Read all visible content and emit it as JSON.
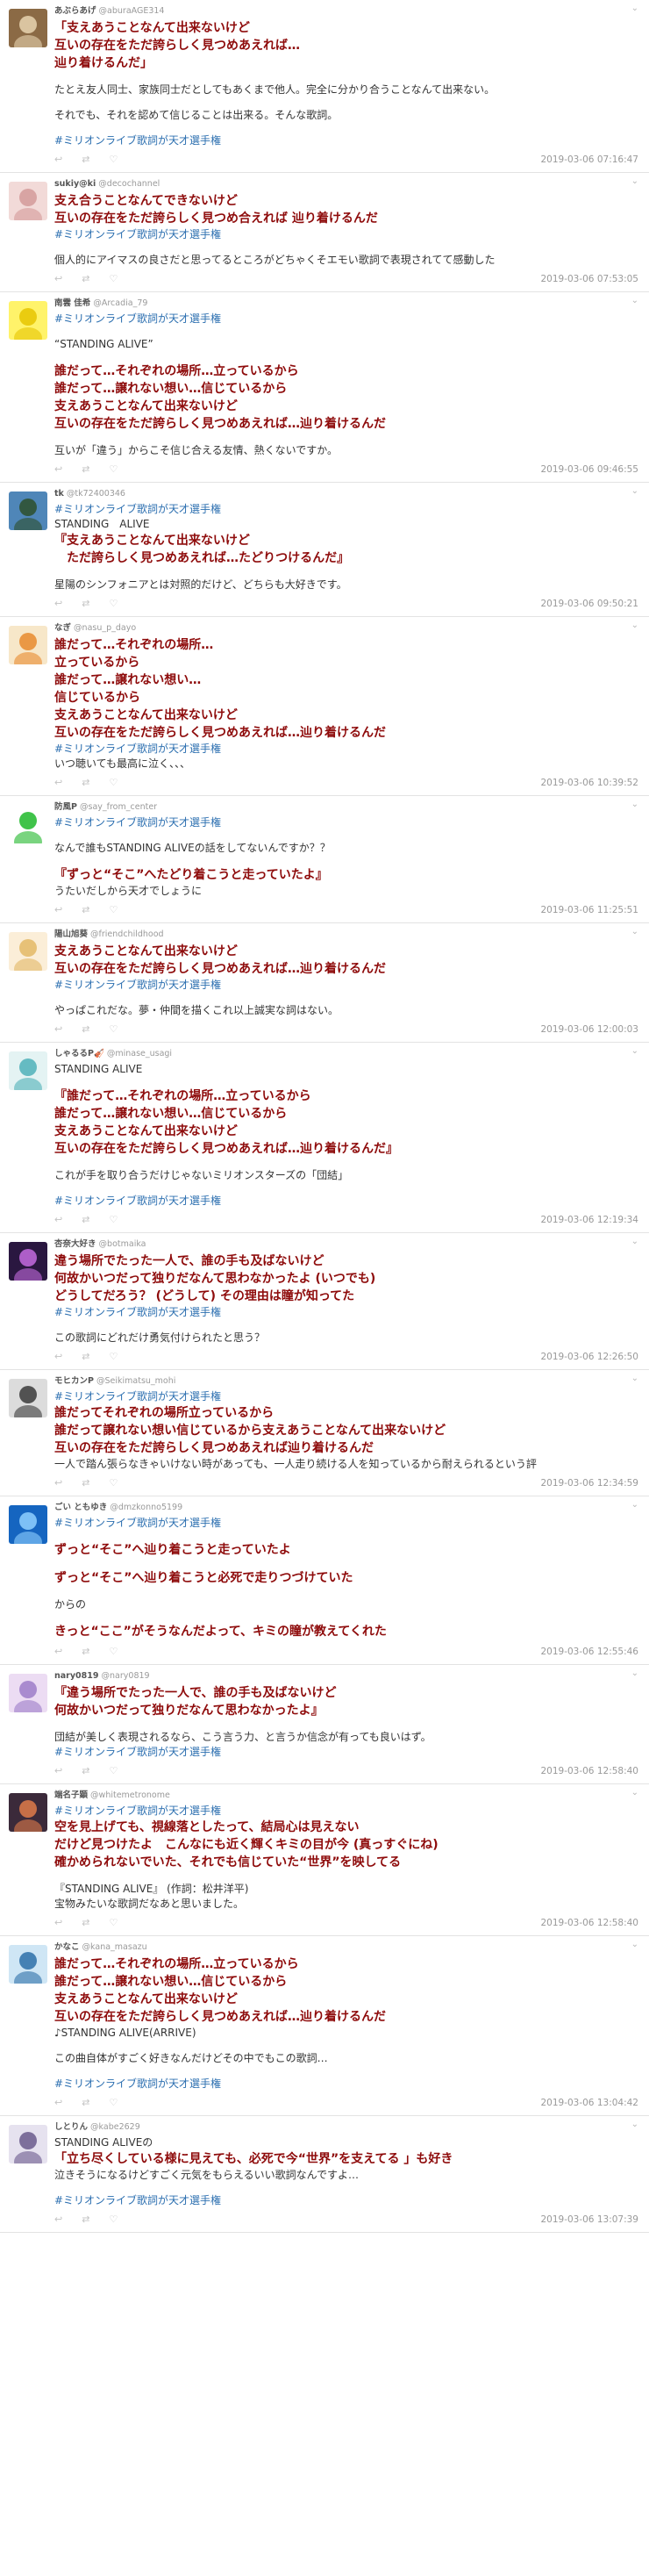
{
  "tweets": [
    {
      "display_name": "あぶらあげ",
      "handle": "@aburaAGE314",
      "avatar": {
        "icon": "brown-cat-avatar",
        "bg": "#8b6a45",
        "fg": "#e8d3b0"
      },
      "lines": [
        {
          "k": "q",
          "text": "「支えあうことなんて出来ないけど"
        },
        {
          "k": "q",
          "text": "互いの存在をただ誇らしく見つめあえれば…"
        },
        {
          "k": "q",
          "text": "辿り着けるんだ」"
        },
        {
          "k": "gap",
          "text": ""
        },
        {
          "k": "t",
          "text": "たとえ友人同士、家族同士だとしてもあくまで他人。完全に分かり合うことなんて出来ない。"
        },
        {
          "k": "gap",
          "text": ""
        },
        {
          "k": "t",
          "text": "それでも、それを認めて信じることは出来る。そんな歌詞。"
        },
        {
          "k": "gap",
          "text": ""
        },
        {
          "k": "h",
          "text": "#ミリオンライブ歌詞が天才選手権"
        }
      ],
      "time": "2019-03-06 07:16:47"
    },
    {
      "display_name": "sukiy@ki",
      "handle": "@decochannel",
      "avatar": {
        "icon": "pink-hair-girl-avatar",
        "bg": "#f2dad8",
        "fg": "#d49a9a"
      },
      "lines": [
        {
          "k": "q",
          "text": "支え合うことなんてできないけど"
        },
        {
          "k": "q",
          "text": "互いの存在をただ誇らしく見つめ合えれば 辿り着けるんだ"
        },
        {
          "k": "h",
          "text": "#ミリオンライブ歌詞が天才選手権"
        },
        {
          "k": "gap",
          "text": ""
        },
        {
          "k": "t",
          "text": "個人的にアイマスの良さだと思ってるところがどちゃくそエモい歌詞で表現されてて感動した"
        }
      ],
      "time": "2019-03-06 07:53:05"
    },
    {
      "display_name": "南雲 佳希",
      "handle": "@Arcadia_79",
      "avatar": {
        "icon": "yellow-emblem-avatar",
        "bg": "#fff36a",
        "fg": "#e6c400"
      },
      "lines": [
        {
          "k": "h",
          "text": "#ミリオンライブ歌詞が天才選手権"
        },
        {
          "k": "gap",
          "text": ""
        },
        {
          "k": "t",
          "text": "“STANDING ALIVE”"
        },
        {
          "k": "gap",
          "text": ""
        },
        {
          "k": "q",
          "text": "誰だって…それぞれの場所…立っているから"
        },
        {
          "k": "q",
          "text": "誰だって…譲れない想い…信じているから"
        },
        {
          "k": "q",
          "text": "支えあうことなんて出来ないけど"
        },
        {
          "k": "q",
          "text": "互いの存在をただ誇らしく見つめあえれば…辿り着けるんだ"
        },
        {
          "k": "gap",
          "text": ""
        },
        {
          "k": "t",
          "text": "互いが「違う」からこそ信じ合える友情、熱くないですか。"
        }
      ],
      "time": "2019-03-06 09:46:55"
    },
    {
      "display_name": "tk",
      "handle": "@tk72400346",
      "avatar": {
        "icon": "landscape-photo-avatar",
        "bg": "#4f86b8",
        "fg": "#2d4f2a"
      },
      "lines": [
        {
          "k": "h",
          "text": "#ミリオンライブ歌詞が天才選手権"
        },
        {
          "k": "t",
          "text": "STANDING　ALIVE"
        },
        {
          "k": "q",
          "text": "『支えあうことなんて出来ないけど"
        },
        {
          "k": "q",
          "text": "　ただ誇らしく見つめあえれば…たどりつけるんだ』"
        },
        {
          "k": "gap",
          "text": ""
        },
        {
          "k": "t",
          "text": "星陽のシンフォニアとは対照的だけど、どちらも大好きです。"
        }
      ],
      "time": "2019-03-06 09:50:21"
    },
    {
      "display_name": "なぎ",
      "handle": "@nasu_p_dayo",
      "avatar": {
        "icon": "orange-hair-girl-avatar",
        "bg": "#f7e7c9",
        "fg": "#e88a2e"
      },
      "lines": [
        {
          "k": "q",
          "text": "誰だって…それぞれの場所…"
        },
        {
          "k": "q",
          "text": "立っているから"
        },
        {
          "k": "q",
          "text": "誰だって…譲れない想い…"
        },
        {
          "k": "q",
          "text": "信じているから"
        },
        {
          "k": "q",
          "text": "支えあうことなんて出来ないけど"
        },
        {
          "k": "q",
          "text": "互いの存在をただ誇らしく見つめあえれば…辿り着けるんだ"
        },
        {
          "k": "h",
          "text": "#ミリオンライブ歌詞が天才選手権"
        },
        {
          "k": "t",
          "text": "いつ聴いても最高に泣く、、、"
        }
      ],
      "time": "2019-03-06 10:39:52"
    },
    {
      "display_name": "防風P",
      "handle": "@say_from_center",
      "avatar": {
        "icon": "green-shape-avatar",
        "bg": "#ffffff",
        "fg": "#1fb82a"
      },
      "lines": [
        {
          "k": "h",
          "text": "#ミリオンライブ歌詞が天才選手権"
        },
        {
          "k": "gap",
          "text": ""
        },
        {
          "k": "t",
          "text": "なんで誰もSTANDING ALIVEの話をしてないんですか？？"
        },
        {
          "k": "gap",
          "text": ""
        },
        {
          "k": "q",
          "text": "『ずっと“そこ”へたどり着こうと走っていたよ』"
        },
        {
          "k": "t",
          "text": "うたいだしから天才でしょうに"
        }
      ],
      "time": "2019-03-06 11:25:51"
    },
    {
      "display_name": "陽山旭葵",
      "handle": "@friendchildhood",
      "avatar": {
        "icon": "blonde-girl-avatar",
        "bg": "#fbeed8",
        "fg": "#e3b866"
      },
      "lines": [
        {
          "k": "q",
          "text": "支えあうことなんて出来ないけど"
        },
        {
          "k": "q",
          "text": "互いの存在をただ誇らしく見つめあえれば…辿り着けるんだ"
        },
        {
          "k": "h",
          "text": "#ミリオンライブ歌詞が天才選手権"
        },
        {
          "k": "gap",
          "text": ""
        },
        {
          "k": "t",
          "text": "やっぱこれだな。夢・仲間を描くこれ以上誠実な詞はない。"
        }
      ],
      "time": "2019-03-06 12:00:03"
    },
    {
      "display_name": "しゃるるP🎻",
      "handle": "@minase_usagi",
      "avatar": {
        "icon": "teal-hair-girl-avatar",
        "bg": "#e4f3f3",
        "fg": "#4fb0b8"
      },
      "lines": [
        {
          "k": "t",
          "text": "STANDING ALIVE"
        },
        {
          "k": "gap",
          "text": ""
        },
        {
          "k": "q",
          "text": "『誰だって…それぞれの場所…立っているから"
        },
        {
          "k": "q",
          "text": "誰だって…譲れない想い…信じているから"
        },
        {
          "k": "q",
          "text": "支えあうことなんて出来ないけど"
        },
        {
          "k": "q",
          "text": "互いの存在をただ誇らしく見つめあえれば…辿り着けるんだ』"
        },
        {
          "k": "gap",
          "text": ""
        },
        {
          "k": "t",
          "text": "これが手を取り合うだけじゃないミリオンスターズの「団結」"
        },
        {
          "k": "gap",
          "text": ""
        },
        {
          "k": "h",
          "text": "#ミリオンライブ歌詞が天才選手権"
        }
      ],
      "time": "2019-03-06 12:19:34"
    },
    {
      "display_name": "杏奈大好き",
      "handle": "@botmaika",
      "avatar": {
        "icon": "purple-sparkle-avatar",
        "bg": "#2a1740",
        "fg": "#c46be0"
      },
      "lines": [
        {
          "k": "q",
          "text": "違う場所でたった一人で、誰の手も及ばないけど"
        },
        {
          "k": "q",
          "text": "何故かいつだって独りだなんて思わなかったよ (いつでも)"
        },
        {
          "k": "q",
          "text": "どうしてだろう？ (どうして) その理由は瞳が知ってた"
        },
        {
          "k": "h",
          "text": "#ミリオンライブ歌詞が天才選手権"
        },
        {
          "k": "gap",
          "text": ""
        },
        {
          "k": "t",
          "text": "この歌詞にどれだけ勇気付けられたと思う？"
        }
      ],
      "time": "2019-03-06 12:26:50"
    },
    {
      "display_name": "モヒカンP",
      "handle": "@Seikimatsu_mohi",
      "avatar": {
        "icon": "monochrome-manga-avatar",
        "bg": "#dcdcdc",
        "fg": "#3a3a3a"
      },
      "lines": [
        {
          "k": "h",
          "text": "#ミリオンライブ歌詞が天才選手権"
        },
        {
          "k": "q",
          "text": "誰だってそれぞれの場所立っているから"
        },
        {
          "k": "q",
          "text": "誰だって譲れない想い信じているから支えあうことなんて出来ないけど"
        },
        {
          "k": "q",
          "text": "互いの存在をただ誇らしく見つめあえれば辿り着けるんだ"
        },
        {
          "k": "t",
          "text": "一人で踏ん張らなきゃいけない時があっても、一人走り続ける人を知っているから耐えられるという評"
        }
      ],
      "time": "2019-03-06 12:34:59"
    },
    {
      "display_name": "ごい ともゆき",
      "handle": "@dmzkonno5199",
      "avatar": {
        "icon": "blue-logo-avatar",
        "bg": "#1565c0",
        "fg": "#8fd0ff"
      },
      "lines": [
        {
          "k": "h",
          "text": "#ミリオンライブ歌詞が天才選手権"
        },
        {
          "k": "gap",
          "text": ""
        },
        {
          "k": "q",
          "text": "ずっと“そこ”へ辿り着こうと走っていたよ"
        },
        {
          "k": "gap",
          "text": ""
        },
        {
          "k": "q",
          "text": "ずっと“そこ”へ辿り着こうと必死で走りつづけていた"
        },
        {
          "k": "gap",
          "text": ""
        },
        {
          "k": "t",
          "text": "からの"
        },
        {
          "k": "gap",
          "text": ""
        },
        {
          "k": "q",
          "text": "きっと“ここ”がそうなんだよって、キミの瞳が教えてくれた"
        }
      ],
      "time": "2019-03-06 12:55:46"
    },
    {
      "display_name": "nary0819",
      "handle": "@nary0819",
      "avatar": {
        "icon": "lavender-girl-avatar",
        "bg": "#ecdcf3",
        "fg": "#9d7cc8"
      },
      "lines": [
        {
          "k": "q",
          "text": "『違う場所でたった一人で、誰の手も及ばないけど"
        },
        {
          "k": "q",
          "text": "何故かいつだって独りだなんて思わなかったよ』"
        },
        {
          "k": "gap",
          "text": ""
        },
        {
          "k": "t",
          "text": "団結が美しく表現されるなら、こう言う力、と言うか信念が有っても良いはず。"
        },
        {
          "k": "h",
          "text": "#ミリオンライブ歌詞が天才選手権"
        }
      ],
      "time": "2019-03-06 12:58:40"
    },
    {
      "display_name": "端名子顕",
      "handle": "@whitemetronome",
      "avatar": {
        "icon": "dark-haired-character-avatar",
        "bg": "#3b2a3a",
        "fg": "#e07b4a"
      },
      "lines": [
        {
          "k": "h",
          "text": "#ミリオンライブ歌詞が天才選手権"
        },
        {
          "k": "q",
          "text": "空を見上げても、視線落としたって、結局心は見えない"
        },
        {
          "k": "q",
          "text": "だけど見つけたよ　こんなにも近く輝くキミの目が今 (真っすぐにね)"
        },
        {
          "k": "q",
          "text": "確かめられないでいた、それでも信じていた“世界”を映してる"
        },
        {
          "k": "gap",
          "text": ""
        },
        {
          "k": "t",
          "text": "『STANDING ALIVE』 (作詞：松井洋平)"
        },
        {
          "k": "t",
          "text": "宝物みたいな歌詞だなあと思いました。"
        }
      ],
      "time": "2019-03-06 12:58:40"
    },
    {
      "display_name": "かなこ",
      "handle": "@kana_masazu",
      "avatar": {
        "icon": "blue-portrait-avatar",
        "bg": "#cfe6f5",
        "fg": "#2d6fa8"
      },
      "lines": [
        {
          "k": "q",
          "text": "誰だって…それぞれの場所…立っているから"
        },
        {
          "k": "q",
          "text": "誰だって…譲れない想い…信じているから"
        },
        {
          "k": "q",
          "text": "支えあうことなんて出来ないけど"
        },
        {
          "k": "q",
          "text": "互いの存在をただ誇らしく見つめあえれば…辿り着けるんだ"
        },
        {
          "k": "t",
          "text": "♪STANDING ALIVE(ARRIVE)"
        },
        {
          "k": "gap",
          "text": ""
        },
        {
          "k": "t",
          "text": "この曲自体がすごく好きなんだけどその中でもこの歌詞…"
        },
        {
          "k": "gap",
          "text": ""
        },
        {
          "k": "h",
          "text": "#ミリオンライブ歌詞が天才選手権"
        }
      ],
      "time": "2019-03-06 13:04:42"
    },
    {
      "display_name": "しとりん",
      "handle": "@kabe2629",
      "avatar": {
        "icon": "silver-hair-girl-avatar",
        "bg": "#e6e2ef",
        "fg": "#6a5a8c"
      },
      "lines": [
        {
          "k": "t",
          "text": "STANDING ALIVEの"
        },
        {
          "k": "q",
          "text": "「立ち尽くしている様に見えても、必死で今“世界”を支えてる 」も好き"
        },
        {
          "k": "t",
          "text": "泣きそうになるけどすごく元気をもらえるいい歌詞なんですよ…"
        },
        {
          "k": "gap",
          "text": ""
        },
        {
          "k": "h",
          "text": "#ミリオンライブ歌詞が天才選手権"
        }
      ],
      "time": "2019-03-06 13:07:39"
    }
  ],
  "icons": {
    "reply": "↩",
    "retweet": "⇄",
    "like": "♡",
    "more": "⌄"
  }
}
